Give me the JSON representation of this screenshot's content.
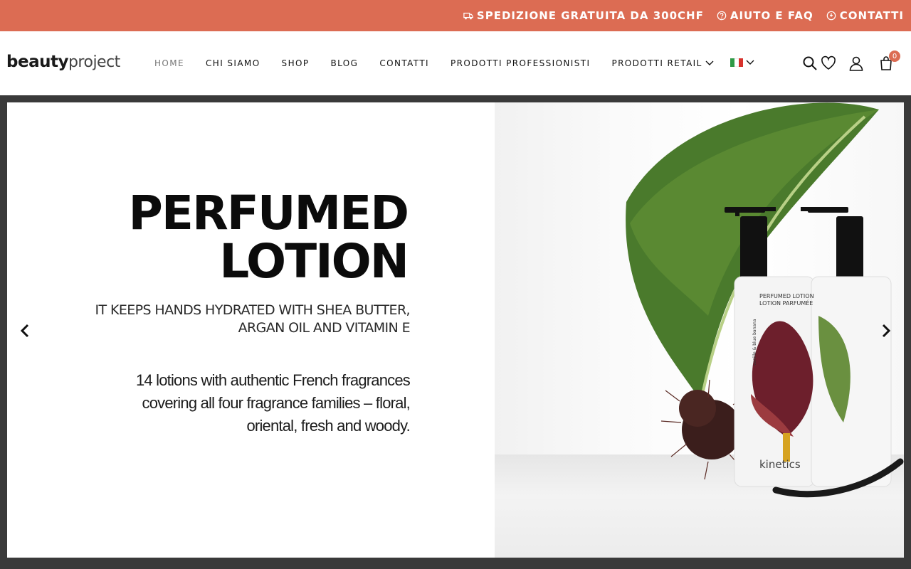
{
  "topbar": {
    "shipping": "SPEDIZIONE GRATUITA DA 300CHF",
    "help": "AIUTO E FAQ",
    "contacts": "CONTATTI"
  },
  "logo": {
    "bold": "beauty",
    "light": "project"
  },
  "nav": {
    "home": "HOME",
    "about": "CHI SIAMO",
    "shop": "SHOP",
    "blog": "BLOG",
    "contacts": "CONTATTI",
    "pro_products": "PRODOTTI PROFESSIONISTI",
    "retail_products": "PRODOTTI RETAIL"
  },
  "cart": {
    "count": "0"
  },
  "hero": {
    "title_line1": "PERFUMED",
    "title_line2": "LOTION",
    "subtitle_line1": "IT KEEPS HANDS HYDRATED WITH SHEA BUTTER,",
    "subtitle_line2": "ARGAN OIL AND VITAMIN E",
    "desc_line1": "14 lotions with authentic French fragrances",
    "desc_line2": "covering all four fragrance families – floral,",
    "desc_line3": "oriental, fresh and woody.",
    "bottle_label1": "PERFUMED LOTION",
    "bottle_label2": "LOTION PARFUMÉE",
    "bottle_scent": "vanille & blue banana",
    "brand": "kinetics"
  },
  "colors": {
    "accent": "#dc6c53",
    "frame": "#3a3a3a",
    "leaf": "#4f7a2a"
  }
}
